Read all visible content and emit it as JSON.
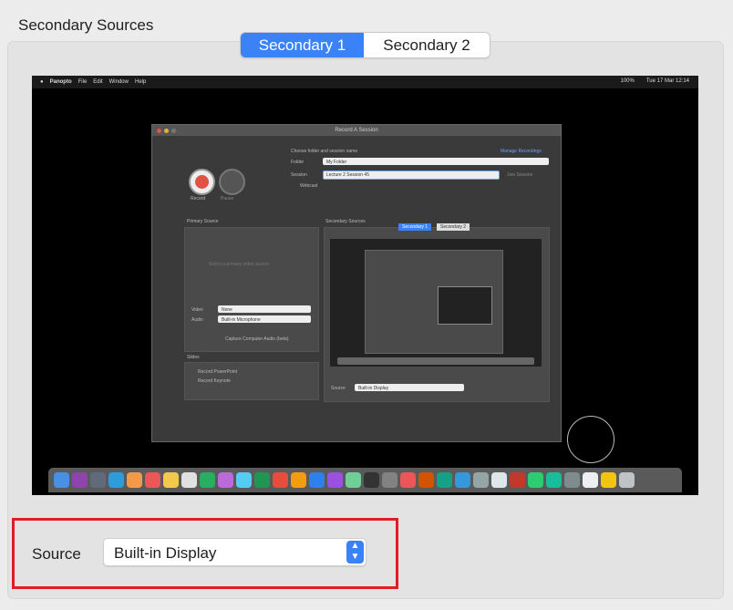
{
  "section": {
    "title": "Secondary Sources"
  },
  "tabs": [
    {
      "label": "Secondary 1",
      "active": true
    },
    {
      "label": "Secondary 2",
      "active": false
    }
  ],
  "preview": {
    "menubar": {
      "app": "Panopto",
      "items": [
        "File",
        "Edit",
        "Window",
        "Help"
      ],
      "clock": "Tue 17 Mar 12:14",
      "battery": "100%"
    },
    "window": {
      "title": "Record A Session",
      "prompt": "Choose folder and session name",
      "manage_link": "Manage Recordings",
      "folder_label": "Folder",
      "folder_value": "My Folder",
      "session_label": "Session",
      "session_value": "Lecture 2 Session 45",
      "join_session": "Join Session",
      "webcast": "Webcast",
      "record_label": "Record",
      "pause_label": "Pause",
      "primary_title": "Primary Source",
      "primary_placeholder": "Select a primary video source",
      "video_label": "Video",
      "video_value": "None",
      "audio_label": "Audio",
      "audio_value": "Built-in Microphone",
      "capture_audio": "Capture Computer Audio (beta)",
      "slides_title": "Slides",
      "record_powerpoint": "Record PowerPoint",
      "record_keynote": "Record Keynote",
      "secondary_title": "Secondary Sources",
      "inner_tab1": "Secondary 1",
      "inner_tab2": "Secondary 2",
      "source_label": "Source",
      "source_value": "Built-in Display"
    }
  },
  "source_control": {
    "label": "Source",
    "value": "Built-in Display"
  },
  "colors": {
    "accent": "#3b82f6",
    "highlight_border": "#e01d22",
    "record_red": "#e05343"
  },
  "dock_icon_count": 32
}
